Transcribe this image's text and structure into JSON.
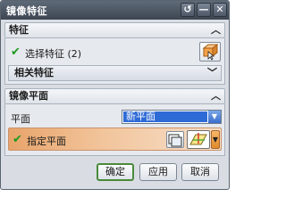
{
  "window": {
    "title": "镜像特征"
  },
  "titlebar_buttons": {
    "reset": "↺",
    "minimize": "—",
    "close": "✕"
  },
  "features_section": {
    "header": "特征",
    "select_label": "选择特征 (2)",
    "related_header": "相关特征"
  },
  "mirror_plane_section": {
    "header": "镜像平面",
    "plane_label": "平面",
    "plane_value": "新平面",
    "specify_plane_label": "指定平面"
  },
  "footer": {
    "ok_label": "确定",
    "apply_label": "应用",
    "cancel_label": "取消"
  },
  "colors": {
    "title_bar": "#4a5563",
    "check": "#1e9a1e",
    "selection_highlight": "#e8a46b",
    "select_value_bg": "#2f6bd6"
  },
  "icons": {
    "collapse": "chevron-up-icon",
    "expand": "chevron-down-icon",
    "feature_select": "select-feature-icon",
    "plane_dialog": "plane-dialog-icon",
    "plane_tool": "plane-tool-icon"
  }
}
